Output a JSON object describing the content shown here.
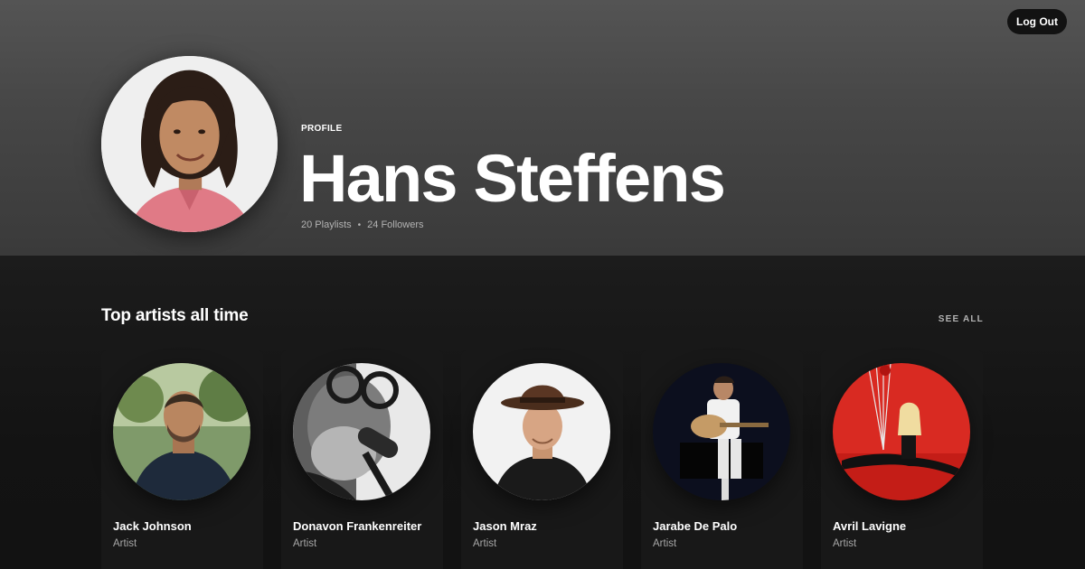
{
  "header": {
    "logout_label": "Log Out",
    "kicker": "PROFILE",
    "name": "Hans Steffens",
    "playlists": "20 Playlists",
    "separator": "•",
    "followers": "24 Followers"
  },
  "top_artists": {
    "title": "Top artists all time",
    "see_all_label": "SEE ALL",
    "items": [
      {
        "name": "Jack Johnson",
        "type": "Artist"
      },
      {
        "name": "Donavon Frankenreiter",
        "type": "Artist"
      },
      {
        "name": "Jason Mraz",
        "type": "Artist"
      },
      {
        "name": "Jarabe De Palo",
        "type": "Artist"
      },
      {
        "name": "Avril Lavigne",
        "type": "Artist"
      }
    ]
  },
  "colors": {
    "background": "#121212",
    "card": "#181818",
    "header_top": "#545454",
    "muted_text": "#b3b3b3"
  }
}
